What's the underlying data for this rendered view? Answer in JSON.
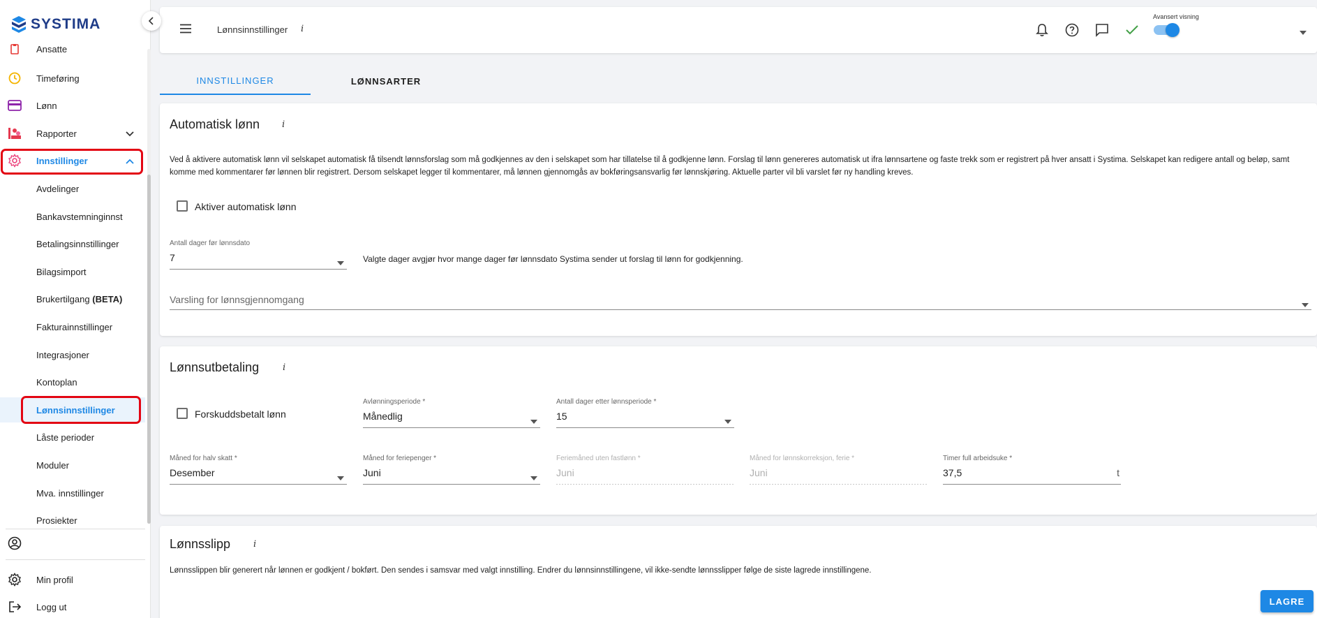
{
  "brand": {
    "name": "SYSTIMA",
    "color": "#1f3c88"
  },
  "accent": "#1e88e5",
  "highlight_color": "#e30613",
  "sidebar": {
    "items": [
      {
        "label": "Ansatte",
        "icon": "clipboard-icon"
      },
      {
        "label": "Timeføring",
        "icon": "clock-icon"
      },
      {
        "label": "Lønn",
        "icon": "credit-card-icon"
      },
      {
        "label": "Rapporter",
        "icon": "chart-icon"
      },
      {
        "label": "Innstillinger",
        "icon": "gear-icon"
      }
    ],
    "sub_items": [
      {
        "label": "Avdelinger"
      },
      {
        "label": "Bankavstemninginnst"
      },
      {
        "label": "Betalingsinnstillinger"
      },
      {
        "label": "Bilagsimport"
      },
      {
        "label": "Brukertilgang",
        "suffix": "(BETA)"
      },
      {
        "label": "Fakturainnstillinger"
      },
      {
        "label": "Integrasjoner"
      },
      {
        "label": "Kontoplan"
      },
      {
        "label": "Lønnsinnstillinger"
      },
      {
        "label": "Låste perioder"
      },
      {
        "label": "Moduler"
      },
      {
        "label": "Mva. innstillinger"
      },
      {
        "label": "Prosjekter"
      }
    ],
    "bottom": {
      "profile_label": "Min profil",
      "logout_label": "Logg ut"
    }
  },
  "header": {
    "title": "Lønnsinnstillinger",
    "info": "i",
    "advanced_label": "Avansert visning"
  },
  "tabs": [
    {
      "label": "INNSTILLINGER"
    },
    {
      "label": "LØNNSARTER"
    }
  ],
  "auto_salary": {
    "title": "Automatisk lønn",
    "info": "i",
    "description": "Ved å aktivere automatisk lønn vil selskapet automatisk få tilsendt lønnsforslag som må godkjennes av den i selskapet som har tillatelse til å godkjenne lønn. Forslag til lønn genereres automatisk ut ifra lønnsartene og faste trekk som er registrert på hver ansatt i Systima. Selskapet kan redigere antall og beløp, samt komme med kommentarer før lønnen blir registrert. Dersom selskapet legger til kommentarer, må lønnen gjennomgås av bokføringsansvarlig før lønnskjøring. Aktuelle parter vil bli varslet før ny handling kreves.",
    "checkbox_label": "Aktiver automatisk lønn",
    "days_label": "Antall dager før lønnsdato",
    "days_value": "7",
    "days_help": "Valgte dager avgjør hvor mange dager før lønnsdato Systima sender ut forslag til lønn for godkjenning.",
    "notify_placeholder": "Varsling for lønnsgjennomgang"
  },
  "payout": {
    "title": "Lønnsutbetaling",
    "info": "i",
    "advance_label": "Forskuddsbetalt lønn",
    "period_label": "Avlønningsperiode *",
    "period_value": "Månedlig",
    "days_after_label": "Antall dager etter lønnsperiode *",
    "days_after_value": "15",
    "half_tax_label": "Måned for halv skatt *",
    "half_tax_value": "Desember",
    "holiday_pay_label": "Måned for feriepenger *",
    "holiday_pay_value": "Juni",
    "holiday_month_label": "Feriemåned uten fastlønn *",
    "holiday_month_value": "Juni",
    "correction_label": "Måned for lønnskorreksjon, ferie *",
    "correction_value": "Juni",
    "hours_label": "Timer full arbeidsuke *",
    "hours_value": "37,5",
    "hours_suffix": "t"
  },
  "payslip": {
    "title": "Lønnsslipp",
    "info": "i",
    "description": "Lønnsslippen blir generert når lønnen er godkjent / bokført. Den sendes i samsvar med valgt innstilling. Endrer du lønnsinnstillingene, vil ikke-sendte lønnsslipper følge de siste lagrede innstillingene."
  },
  "save_label": "LAGRE"
}
